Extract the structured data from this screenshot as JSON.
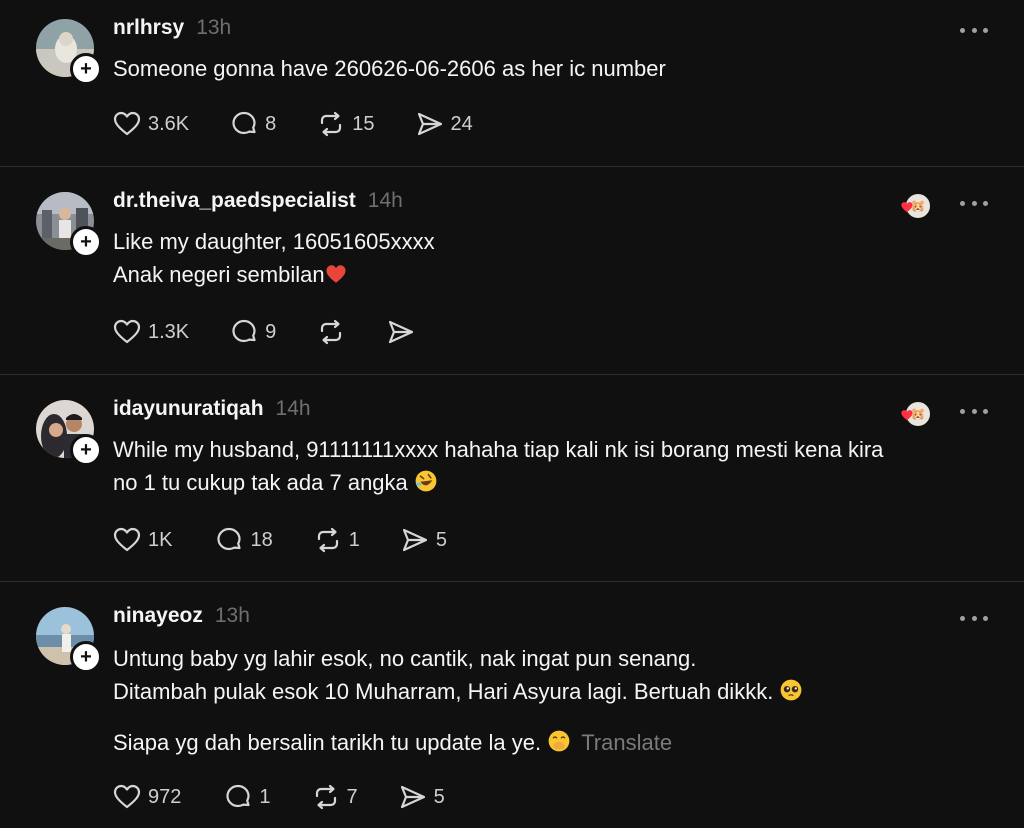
{
  "posts": [
    {
      "username": "nrlhrsy",
      "time": "13h",
      "lines": [
        "Someone gonna have 260626-06-2606 as her ic number"
      ],
      "likes": "3.6K",
      "replies": "8",
      "reposts": "15",
      "shares": "24"
    },
    {
      "username": "dr.theiva_paedspecialist",
      "time": "14h",
      "lines": [
        "Like my daughter, 16051605xxxx",
        "Anak negeri sembilan"
      ],
      "emoji_after_line2": "red-heart-emoji",
      "likes": "1.3K",
      "replies": "9",
      "reposts": "",
      "shares": ""
    },
    {
      "username": "idayunuratiqah",
      "time": "14h",
      "lines": [
        "While my husband, 91111111xxxx hahaha tiap kali nk isi borang mesti kena kira",
        "no 1 tu cukup tak ada 7 angka"
      ],
      "emoji_after_line2": "rolling-laughing-emoji",
      "likes": "1K",
      "replies": "18",
      "reposts": "1",
      "shares": "5"
    },
    {
      "username": "ninayeoz",
      "time": "13h",
      "lines": [
        "Untung baby yg lahir esok, no cantik, nak ingat pun senang.",
        "Ditambah pulak esok 10 Muharram, Hari Asyura lagi. Bertuah dikkk.",
        "Siapa yg dah bersalin tarikh tu update la ye."
      ],
      "translate": "Translate",
      "likes": "972",
      "replies": "1",
      "reposts": "7",
      "shares": "5"
    }
  ],
  "icons": {
    "like": "heart-icon",
    "reply": "comment-icon",
    "repost": "repost-icon",
    "share": "send-icon",
    "more": "more-dots-icon",
    "follow": "plus-icon"
  },
  "colors": {
    "background": "#101010",
    "text": "#f3f5f7",
    "muted": "#6f6f6f",
    "divider": "#2c2c2c",
    "heart": "#ff3040"
  }
}
